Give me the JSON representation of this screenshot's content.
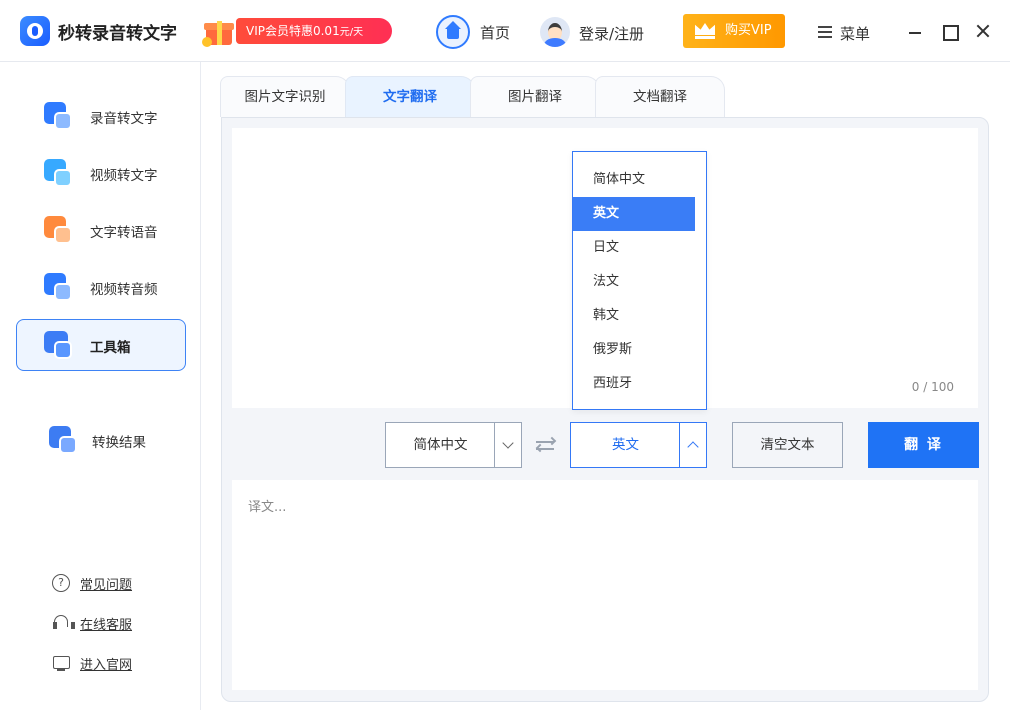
{
  "app": {
    "title": "秒转录音转文字",
    "promo_text": "VIP会员特惠0.01",
    "promo_unit": "元/天",
    "home_label": "首页",
    "login_label": "登录/注册",
    "buy_vip_label": "购买VIP",
    "menu_label": "菜单"
  },
  "sidebar": {
    "items": [
      {
        "label": "录音转文字",
        "icon": "audio-to-text-icon"
      },
      {
        "label": "视频转文字",
        "icon": "video-to-text-icon"
      },
      {
        "label": "文字转语音",
        "icon": "text-to-speech-icon"
      },
      {
        "label": "视频转音频",
        "icon": "video-to-audio-icon"
      },
      {
        "label": "工具箱",
        "icon": "toolbox-icon",
        "active": true
      },
      {
        "label": "转换结果",
        "icon": "results-icon"
      }
    ],
    "links": [
      {
        "label": "常见问题",
        "icon": "help-icon"
      },
      {
        "label": "在线客服",
        "icon": "headset-icon"
      },
      {
        "label": "进入官网",
        "icon": "monitor-icon"
      }
    ]
  },
  "tabs": [
    {
      "label": "图片文字识别"
    },
    {
      "label": "文字翻译",
      "active": true
    },
    {
      "label": "图片翻译"
    },
    {
      "label": "文档翻译"
    }
  ],
  "editor": {
    "char_count": "0 / 100",
    "output_placeholder": "译文..."
  },
  "controls": {
    "source_lang": "简体中文",
    "target_lang": "英文",
    "clear_label": "清空文本",
    "translate_label": "翻 译"
  },
  "dropdown": {
    "options": [
      "简体中文",
      "英文",
      "日文",
      "法文",
      "韩文",
      "俄罗斯",
      "西班牙"
    ],
    "selected": "英文"
  },
  "colors": {
    "accent": "#1f73f5",
    "vip": "#ff9800",
    "promo": "#ff3a46"
  }
}
